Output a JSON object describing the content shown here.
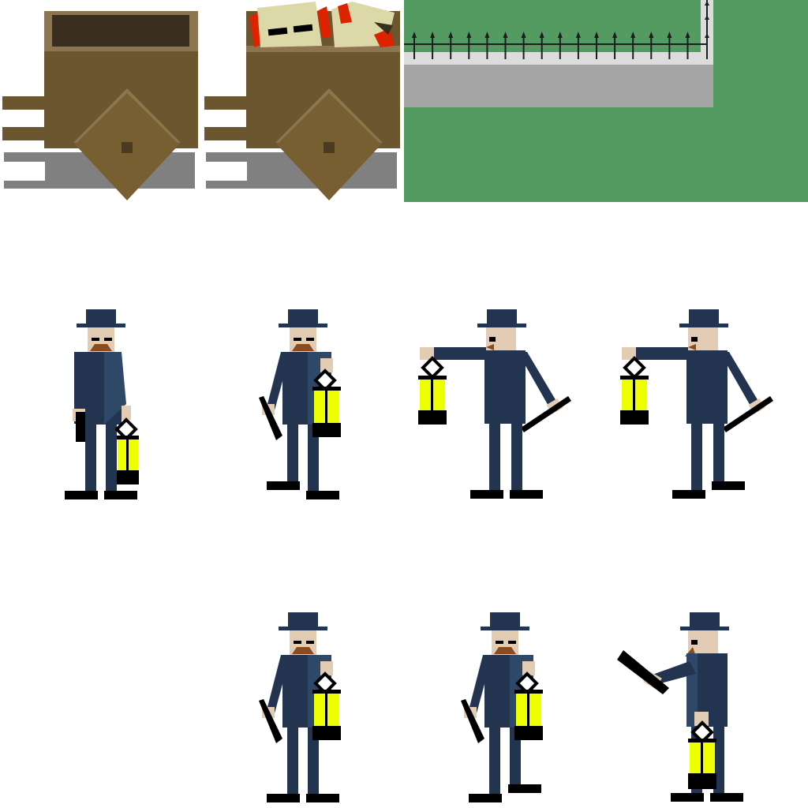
{
  "sheet": {
    "kind": "sprite-sheet",
    "background": "#FFFFFF"
  },
  "colors": {
    "wood_dark": "#6B5630",
    "wood_mid": "#775F32",
    "wood_light": "#8C7550",
    "wood_shadow": "#3A2E1E",
    "knot": "#4A3A22",
    "cart_shadow": "#808080",
    "paper": "#DDD8A7",
    "red": "#DD2200",
    "ink": "#000000",
    "grass": "#539B60",
    "path_light": "#DCDCDC",
    "path_dark": "#A5A5A5",
    "fence": "#1E1E1E",
    "coat": "#22344F",
    "coat_light": "#2F4868",
    "skin": "#E2CCB3",
    "mustache": "#8A4B1F",
    "boot": "#000000",
    "lantern_glow": "#EEFF00",
    "lantern_frame": "#000000",
    "lantern_handle_fill": "#FFFFFF"
  },
  "tiles": [
    {
      "name": "empty-wooden-cart",
      "contents": "empty"
    },
    {
      "name": "wooden-cart-with-papers",
      "contents": "papers"
    },
    {
      "name": "park-path-with-iron-fence",
      "contents": "fence"
    }
  ],
  "characters": {
    "type": "lamplighter",
    "row_1": [
      "idle-front",
      "walk-front",
      "reach-left",
      "reach-left-step"
    ],
    "row_2": [
      "walk-front-alt",
      "walk-front-step",
      "raise-pole"
    ]
  }
}
